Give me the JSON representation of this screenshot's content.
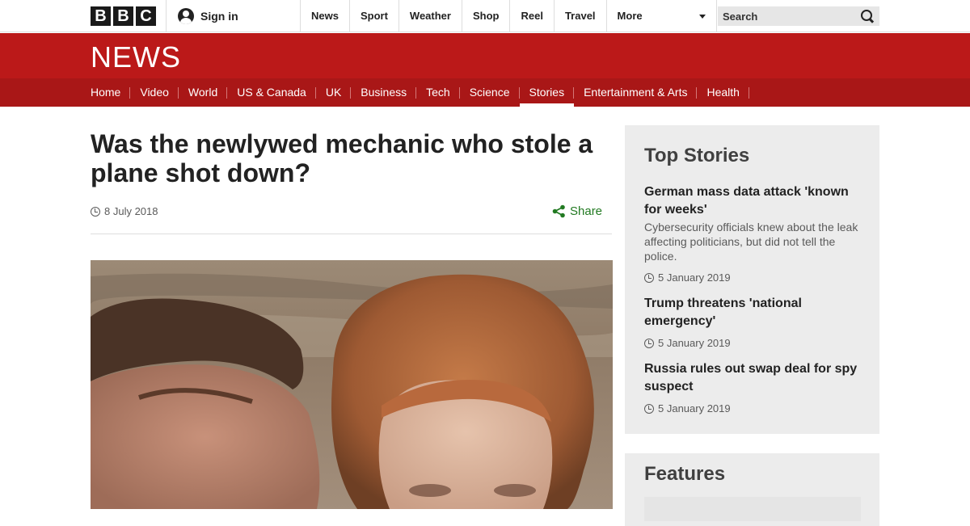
{
  "header": {
    "logo_letters": [
      "B",
      "B",
      "C"
    ],
    "signin_label": "Sign in",
    "nav": [
      "News",
      "Sport",
      "Weather",
      "Shop",
      "Reel",
      "Travel"
    ],
    "more_label": "More",
    "search_placeholder": "Search"
  },
  "brand": {
    "news_logo": "NEWS",
    "red": "#bb1919",
    "red_dark": "#a91717"
  },
  "sections": [
    {
      "label": "Home",
      "active": false
    },
    {
      "label": "Video",
      "active": false
    },
    {
      "label": "World",
      "active": false
    },
    {
      "label": "US & Canada",
      "active": false
    },
    {
      "label": "UK",
      "active": false
    },
    {
      "label": "Business",
      "active": false
    },
    {
      "label": "Tech",
      "active": false
    },
    {
      "label": "Science",
      "active": false
    },
    {
      "label": "Stories",
      "active": true
    },
    {
      "label": "Entertainment & Arts",
      "active": false
    },
    {
      "label": "Health",
      "active": false
    }
  ],
  "article": {
    "headline": "Was the newlywed mechanic who stole a plane shot down?",
    "date": "8 July 2018",
    "share_label": "Share",
    "share_color": "#227a22"
  },
  "sidebar": {
    "top_stories_heading": "Top Stories",
    "stories": [
      {
        "title": "German mass data attack 'known for weeks'",
        "summary": "Cybersecurity officials knew about the leak affecting politicians, but did not tell the police.",
        "date": "5 January 2019"
      },
      {
        "title": "Trump threatens 'national emergency'",
        "date": "5 January 2019"
      },
      {
        "title": "Russia rules out swap deal for spy suspect",
        "date": "5 January 2019"
      }
    ],
    "features_heading": "Features"
  }
}
